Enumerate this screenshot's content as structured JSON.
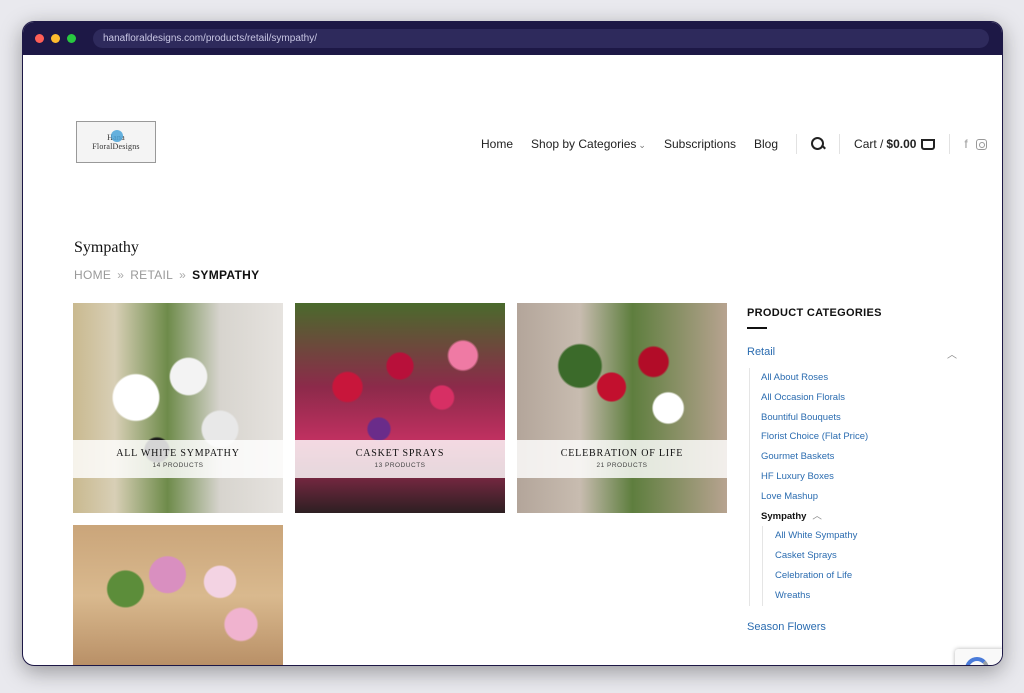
{
  "browser": {
    "url": "hanafloraldesigns.com/products/retail/sympathy/"
  },
  "logo": {
    "line1": "Hana",
    "line2": "FloralDesigns"
  },
  "nav": {
    "home": "Home",
    "shop": "Shop by Categories",
    "subscriptions": "Subscriptions",
    "blog": "Blog",
    "cart_label": "Cart /",
    "cart_total": "$0.00"
  },
  "page": {
    "title": "Sympathy",
    "breadcrumb": [
      "HOME",
      "RETAIL",
      "SYMPATHY"
    ],
    "separator": "»"
  },
  "categories": [
    {
      "name": "ALL WHITE SYMPATHY",
      "count": "14 PRODUCTS"
    },
    {
      "name": "CASKET SPRAYS",
      "count": "13 PRODUCTS"
    },
    {
      "name": "CELEBRATION OF LIFE",
      "count": "21 PRODUCTS"
    },
    {
      "name": "",
      "count": ""
    }
  ],
  "sidebar": {
    "heading": "PRODUCT CATEGORIES",
    "retail": "Retail",
    "items": [
      "All About Roses",
      "All Occasion Florals",
      "Bountiful Bouquets",
      "Florist Choice (Flat Price)",
      "Gourmet Baskets",
      "HF Luxury Boxes",
      "Love Mashup"
    ],
    "active": "Sympathy",
    "sub_items": [
      "All White Sympathy",
      "Casket Sprays",
      "Celebration of Life",
      "Wreaths"
    ],
    "season": "Season Flowers"
  },
  "icons": {
    "search": "search-icon",
    "cart": "basket-icon",
    "facebook": "facebook-icon",
    "instagram": "instagram-icon",
    "collapse": "chevron-up-icon"
  }
}
